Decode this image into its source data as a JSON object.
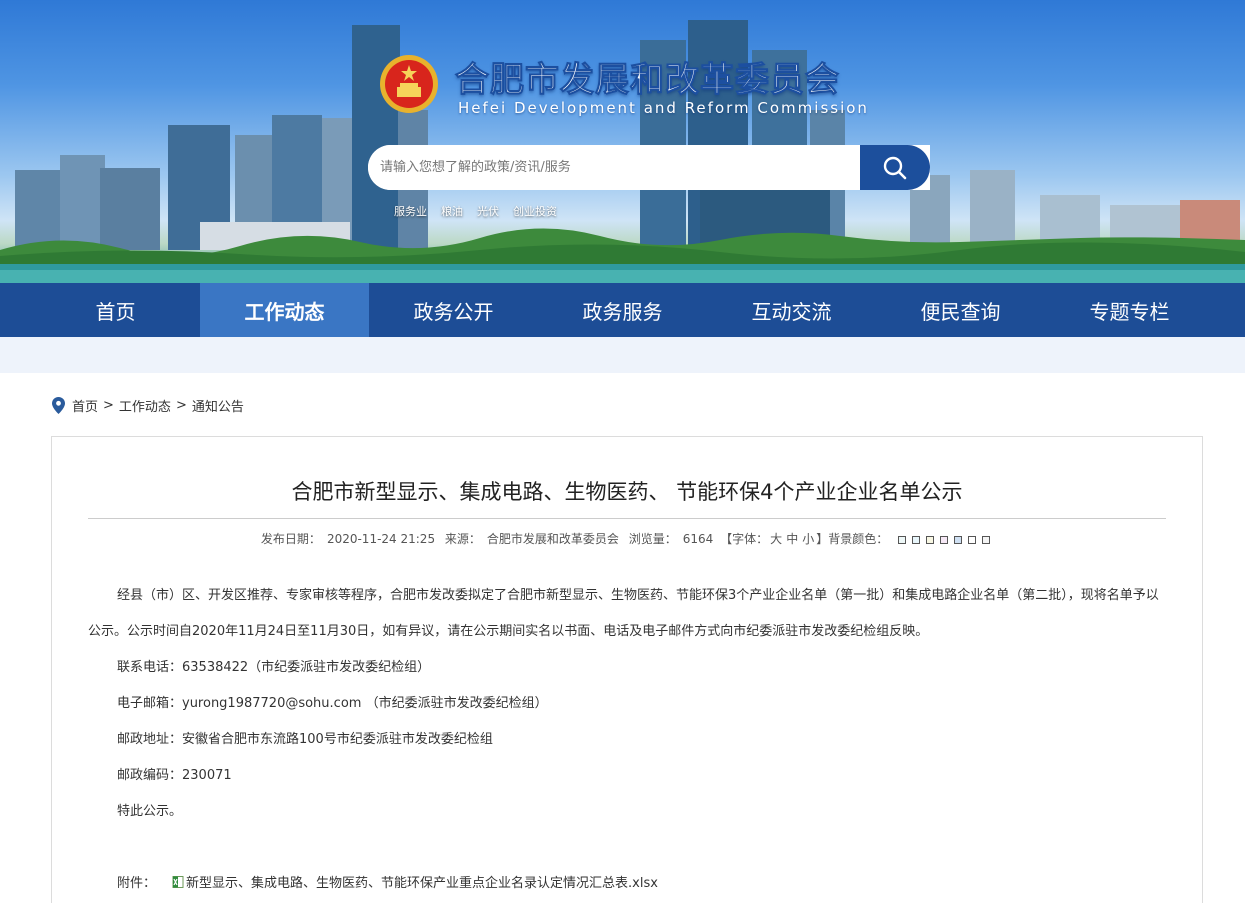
{
  "header": {
    "title": "合肥市发展和改革委员会",
    "subtitle": "Hefei Development and Reform Commission",
    "search_placeholder": "请输入您想了解的政策/资讯/服务",
    "hot_words": [
      "服务业",
      "粮油",
      "光伏",
      "创业投资"
    ]
  },
  "nav": {
    "items": [
      "首页",
      "工作动态",
      "政务公开",
      "政务服务",
      "互动交流",
      "便民查询",
      "专题专栏"
    ],
    "active_index": 1
  },
  "breadcrumb": {
    "items": [
      "首页",
      "工作动态",
      "通知公告"
    ],
    "separator": ">"
  },
  "article": {
    "title": "合肥市新型显示、集成电路、生物医药、 节能环保4个产业企业名单公示",
    "meta": {
      "date_label": "发布日期：",
      "date": "2020-11-24 21:25",
      "source_label": "来源：",
      "source": "合肥市发展和改革委员会",
      "views_label": "浏览量：",
      "views": "6164",
      "font_label_open": "【字体：",
      "font_large": "大",
      "font_medium": "中",
      "font_small": "小",
      "font_label_close": "】",
      "bg_label": "背景颜色：",
      "bg_colors": [
        "#eef8f8",
        "#e8f6fb",
        "#f8f7e3",
        "#f6e8f6",
        "#cfe0f3",
        "#ffffff",
        "#f4f4f4"
      ]
    },
    "paragraph": "经县（市）区、开发区推荐、专家审核等程序，合肥市发改委拟定了合肥市新型显示、生物医药、节能环保3个产业企业名单（第一批）和集成电路企业名单（第二批），现将名单予以公示。公示时间自2020年11月24日至11月30日，如有异议，请在公示期间实名以书面、电话及电子邮件方式向市纪委派驻市发改委纪检组反映。",
    "lines": [
      "联系电话：63538422（市纪委派驻市发改委纪检组）",
      "电子邮箱：yurong1987720@sohu.com （市纪委派驻市发改委纪检组）",
      "邮政地址：安徽省合肥市东流路100号市纪委派驻市发改委纪检组",
      "邮政编码：230071",
      "特此公示。"
    ],
    "attachment_label": "附件：",
    "attachment_file": "新型显示、集成电路、生物医药、节能环保产业重点企业名录认定情况汇总表.xlsx"
  }
}
